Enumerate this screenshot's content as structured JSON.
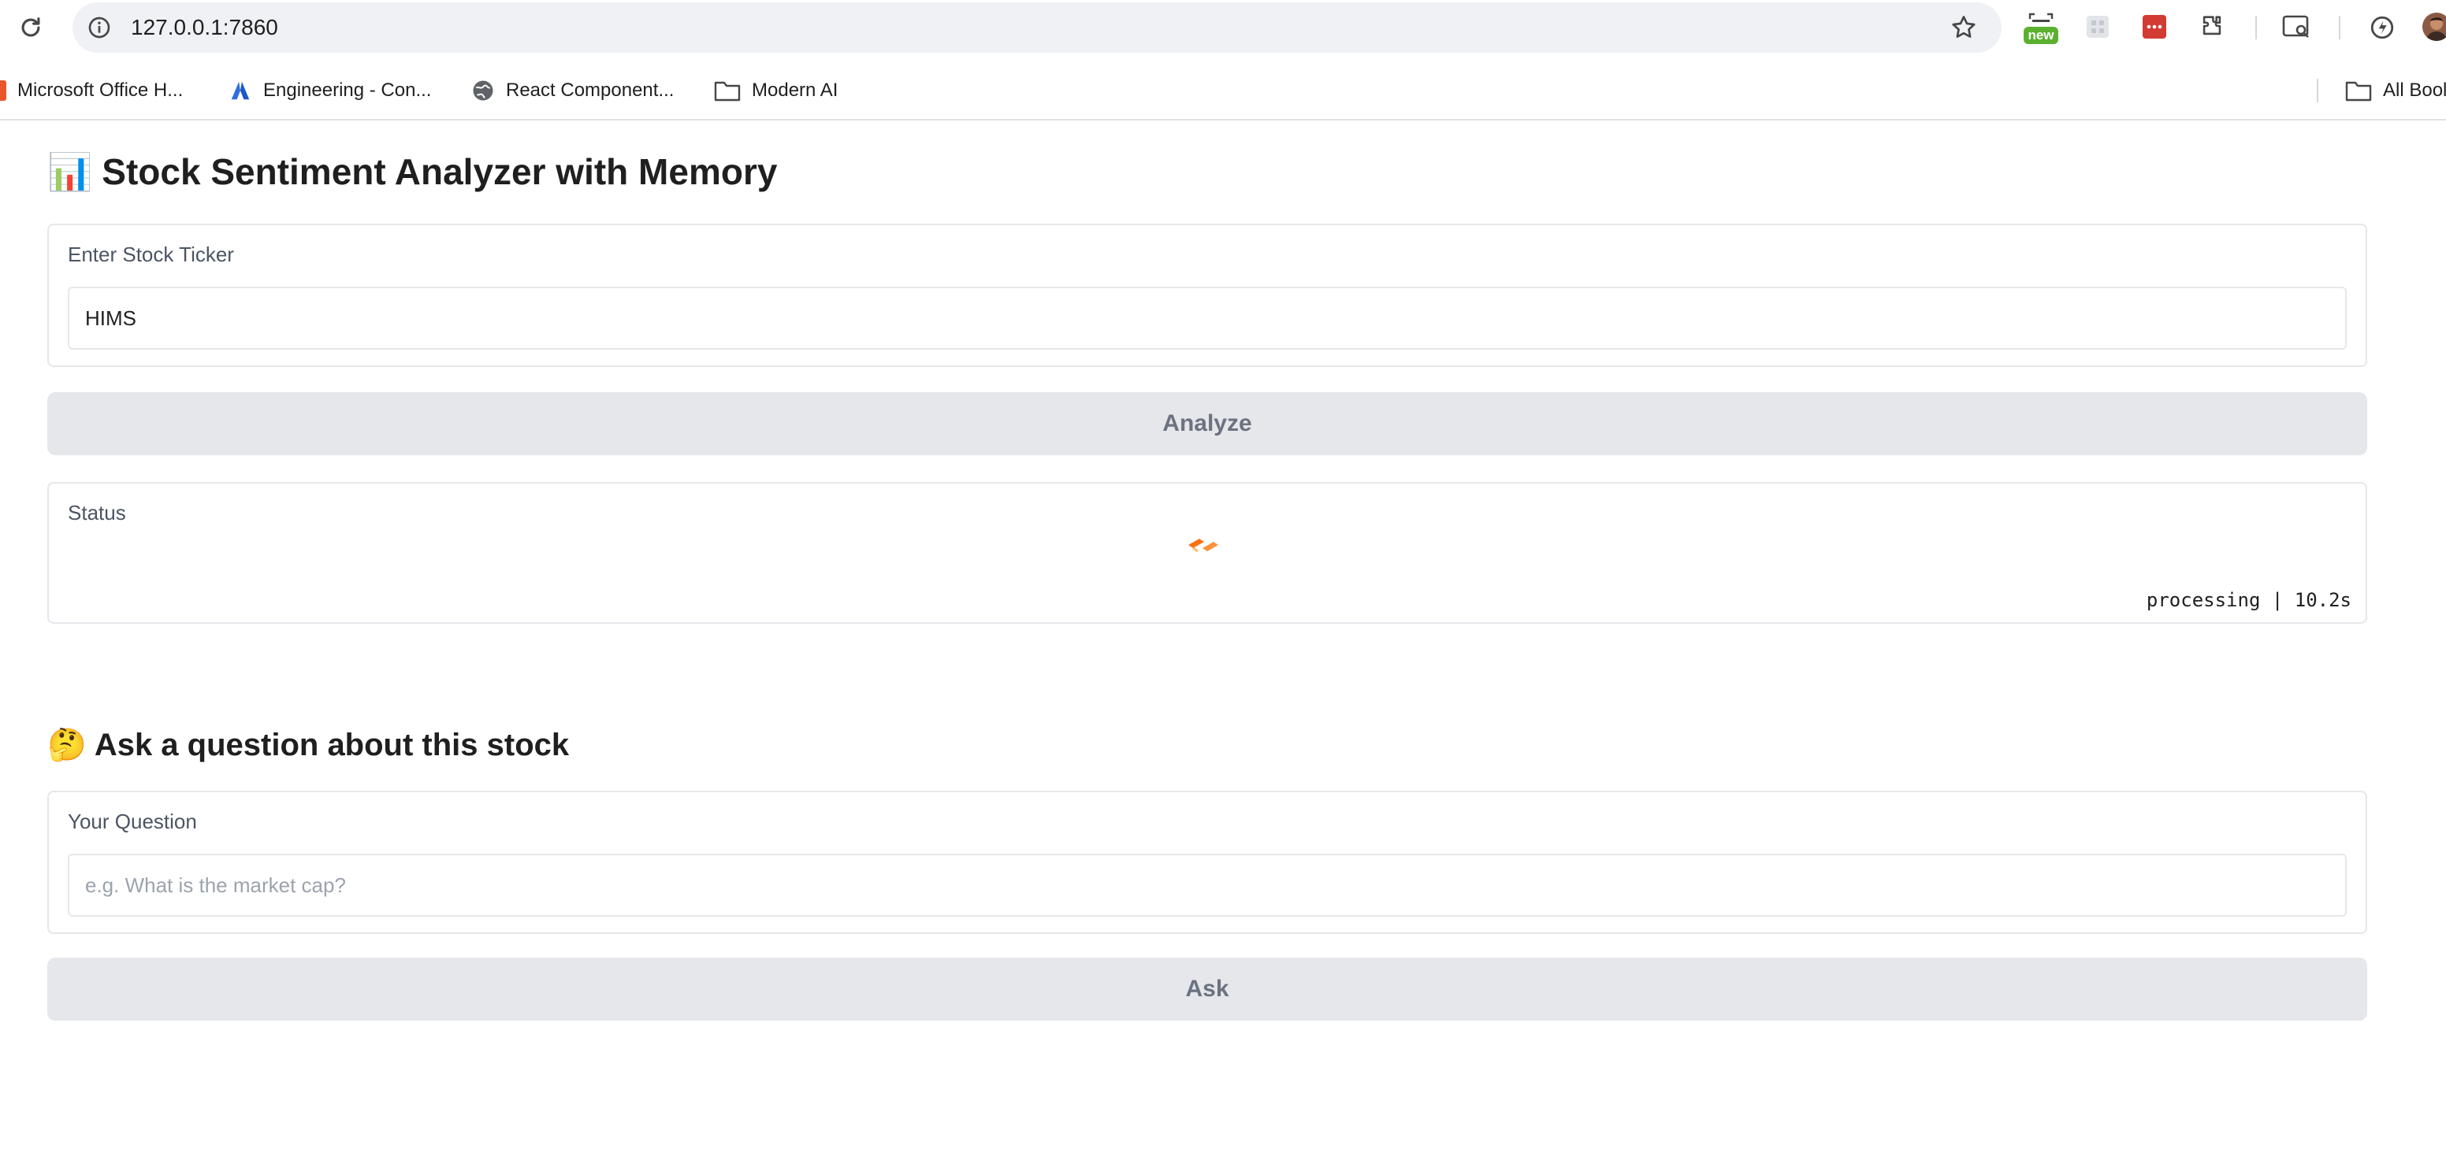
{
  "browser": {
    "url": "127.0.0.1:7860",
    "extension_badge": "new",
    "bookmarks": [
      {
        "label": "Microsoft Office H...",
        "icon": "office-icon"
      },
      {
        "label": "Engineering - Con...",
        "icon": "confluence-icon"
      },
      {
        "label": "React Component...",
        "icon": "globe-icon"
      },
      {
        "label": "Modern AI",
        "icon": "folder-icon"
      }
    ],
    "all_bookmarks_label": "All Bool"
  },
  "app": {
    "title_emoji": "📊",
    "title": "Stock Sentiment Analyzer with Memory",
    "ticker": {
      "label": "Enter Stock Ticker",
      "value": "HIMS"
    },
    "analyze_button": "Analyze",
    "status": {
      "label": "Status",
      "progress_text": "processing | 10.2s"
    },
    "question_section": {
      "emoji": "🤔",
      "title": "Ask a question about this stock"
    },
    "question": {
      "label": "Your Question",
      "placeholder": "e.g. What is the market cap?"
    },
    "ask_button": "Ask"
  },
  "colors": {
    "accent": "#f97316",
    "button_bg": "#e5e7eb",
    "button_text": "#6b7280",
    "border": "#e5e7eb"
  }
}
